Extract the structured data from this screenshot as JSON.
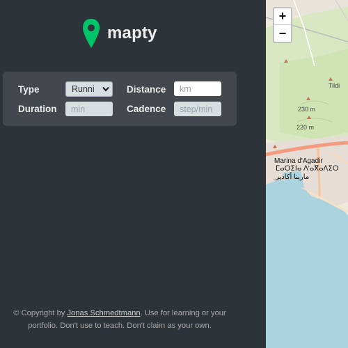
{
  "brand": {
    "name": "mapty",
    "accent": "#00c46a"
  },
  "form": {
    "type_label": "Type",
    "type_value": "Runni",
    "distance_label": "Distance",
    "distance_placeholder": "km",
    "duration_label": "Duration",
    "duration_placeholder": "min",
    "cadence_label": "Cadence",
    "cadence_placeholder": "step/min"
  },
  "footer": {
    "prefix": "© Copyright by ",
    "author": "Jonas Schmedtmann",
    "line1_suffix": ". Use for learning or your",
    "line2": "portfolio. Don't use to teach. Don't claim as your own."
  },
  "map": {
    "zoom_in": "+",
    "zoom_out": "−",
    "labels": {
      "tildi": "Tildi",
      "elev_230": "230 m",
      "elev_220": "220 m",
      "marina": "Marina d'Agadir",
      "tifinagh": "ⵎⴰⵔⵉⵏⴰ ⴷ'ⴰⴳⴰⴷⵉⵔ",
      "arabic": "مارينا أكادير"
    },
    "colors": {
      "land": "#efe9dc",
      "forest": "#cfe3b4",
      "water": "#aad3df",
      "road": "#f7a98f"
    }
  }
}
